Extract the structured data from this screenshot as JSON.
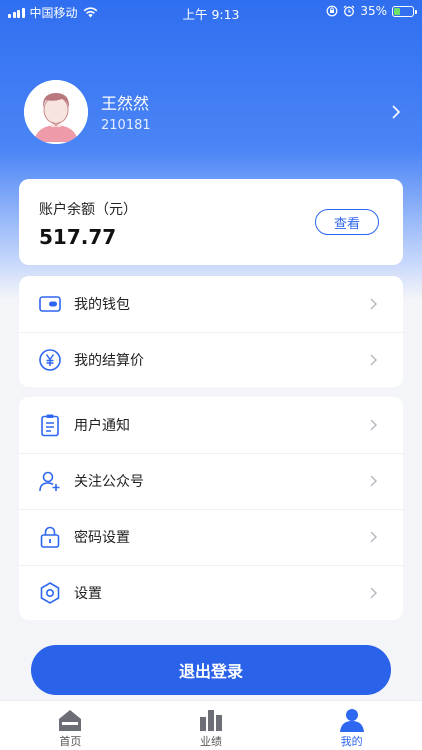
{
  "status_bar": {
    "carrier": "中国移动",
    "time": "上午 9:13",
    "battery": "35%"
  },
  "profile": {
    "name": "王然然",
    "id": "210181"
  },
  "balance": {
    "title": "账户余额（元）",
    "value": "517.77",
    "view_label": "查看"
  },
  "menu_group_1": [
    {
      "label": "我的钱包",
      "icon": "wallet-icon"
    },
    {
      "label": "我的结算价",
      "icon": "yen-icon"
    }
  ],
  "menu_group_2": [
    {
      "label": "用户通知",
      "icon": "clipboard-icon"
    },
    {
      "label": "关注公众号",
      "icon": "user-add-icon"
    },
    {
      "label": "密码设置",
      "icon": "lock-icon"
    },
    {
      "label": "设置",
      "icon": "hexagon-settings-icon"
    }
  ],
  "logout_label": "退出登录",
  "tabs": [
    {
      "label": "首页",
      "icon": "home-icon",
      "active": false
    },
    {
      "label": "业绩",
      "icon": "buildings-icon",
      "active": false
    },
    {
      "label": "我的",
      "icon": "person-icon",
      "active": true
    }
  ],
  "colors": {
    "primary": "#2e67f0",
    "header_gradient_top": "#2f6ef0",
    "background": "#f4f5f8"
  }
}
